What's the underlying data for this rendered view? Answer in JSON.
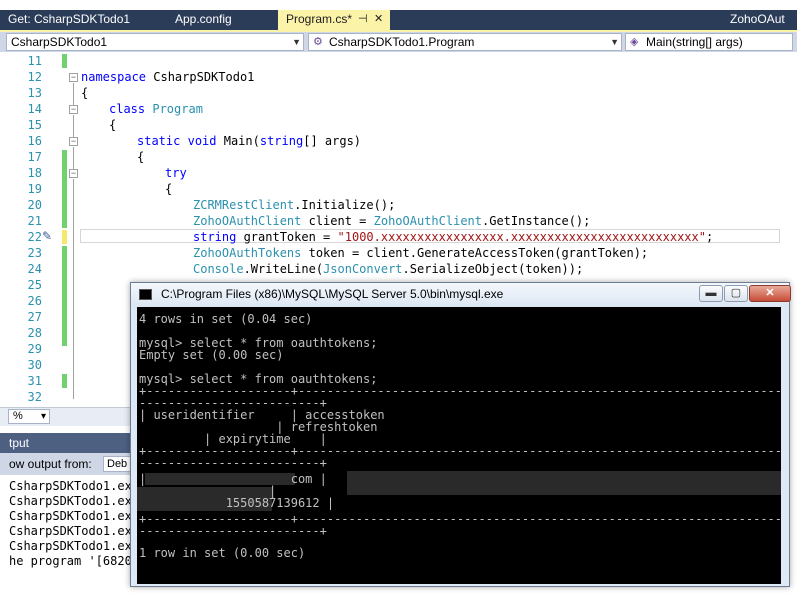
{
  "tabs": [
    {
      "label": "Get: CsharpSDKTodo1"
    },
    {
      "label": "App.config"
    },
    {
      "label": "Program.cs*",
      "pin": "⊣",
      "close": "✕"
    },
    {
      "label": "ZohoOAut"
    }
  ],
  "nav": {
    "project": "CsharpSDKTodo1",
    "class": "CsharpSDKTodo1.Program",
    "member": "Main(string[] args)"
  },
  "editor": {
    "line_numbers": [
      "11",
      "12",
      "13",
      "14",
      "15",
      "16",
      "17",
      "18",
      "19",
      "20",
      "21",
      "22",
      "23",
      "24",
      "25",
      "26",
      "27",
      "28",
      "29",
      "30",
      "31",
      "32"
    ],
    "lines": {
      "l12_kw": "namespace",
      "l12_rest": " CsharpSDKTodo1",
      "l13": "{",
      "l14_kw": "class",
      "l14_ty": "Program",
      "l15": "{",
      "l16_kw1": "static",
      "l16_kw2": "void",
      "l16_name": " Main(",
      "l16_kw3": "string",
      "l16_rest": "[] args)",
      "l17": "{",
      "l18_kw": "try",
      "l19": "{",
      "l20_ty": "ZCRMRestClient",
      "l20_rest": ".Initialize();",
      "l21_ty": "ZohoOAuthClient",
      "l21_mid": " client = ",
      "l21_ty2": "ZohoOAuthClient",
      "l21_rest": ".GetInstance();",
      "l22_kw": "string",
      "l22_mid": " grantToken = ",
      "l22_str": "\"1000.xxxxxxxxxxxxxxxxx.xxxxxxxxxxxxxxxxxxxxxxxxxx\"",
      "l22_end": ";",
      "l23_ty": "ZohoOAuthTokens",
      "l23_rest": " token = client.GenerateAccessToken(grantToken);",
      "l24_ty": "Console",
      "l24_mid": ".WriteLine(",
      "l24_ty2": "JsonConvert",
      "l24_rest": ".SerializeObject(token));"
    }
  },
  "zoom": {
    "value": "%",
    "arrow": "▾"
  },
  "output": {
    "title": "tput",
    "show_from_label": "ow output from:",
    "show_from_value": "Deb",
    "lines": [
      "CsharpSDKTodo1.ex",
      "CsharpSDKTodo1.ex",
      "CsharpSDKTodo1.ex",
      "CsharpSDKTodo1.ex",
      "CsharpSDKTodo1.ex",
      "he program '[6820"
    ]
  },
  "console": {
    "title": "C:\\Program Files (x86)\\MySQL\\MySQL Server 5.0\\bin\\mysql.exe",
    "buttons": {
      "minimize": "▬",
      "maximize": "▢",
      "close": "✕"
    },
    "lines": [
      "4 rows in set (0.04 sec)",
      "",
      "mysql> select * from oauthtokens;",
      "Empty set (0.00 sec)",
      "",
      "mysql> select * from oauthtokens;",
      "+--------------------+-------------------------------------------------------------------------------------",
      "-------------------------+",
      "| useridentifier     | accesstoken",
      "                   | refreshtoken",
      "         | expirytime    |",
      "+--------------------+-------------------------------------------------------------------------------------",
      "-------------------------+",
      "|                    com |",
      "                  |",
      "            1550587139612 |",
      "+--------------------+-------------------------------------------------------------------------------------",
      "-------------------------+",
      "1 row in set (0.00 sec)"
    ]
  }
}
